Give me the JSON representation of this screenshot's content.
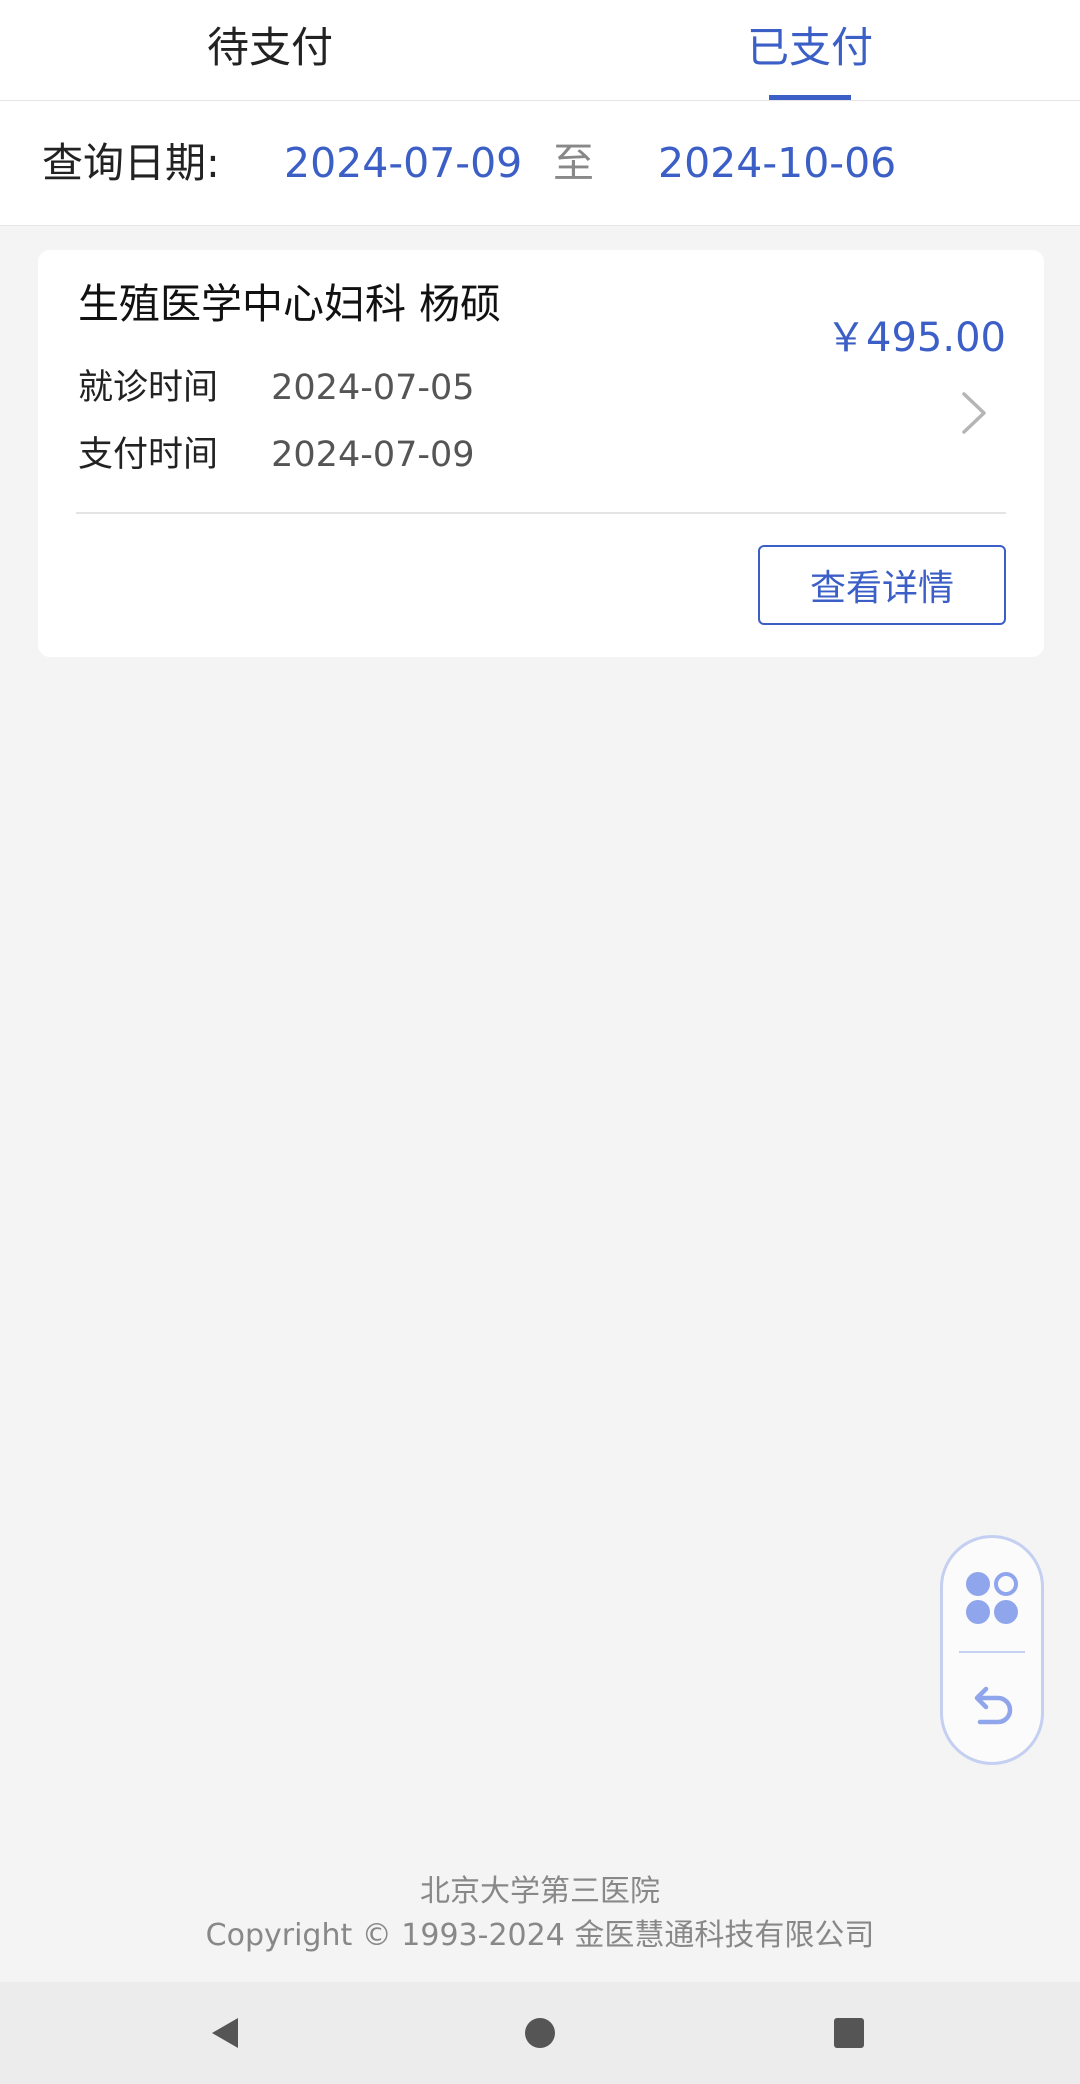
{
  "tabs": [
    {
      "label": "待支付",
      "active": false
    },
    {
      "label": "已支付",
      "active": true
    }
  ],
  "date_filter": {
    "label": "查询日期:",
    "start": "2024-07-09",
    "separator": "至",
    "end": "2024-10-06"
  },
  "records": [
    {
      "title": "生殖医学中心妇科 杨硕",
      "amount": "￥495.00",
      "visit_label": "就诊时间",
      "visit_date": "2024-07-05",
      "pay_label": "支付时间",
      "pay_date": "2024-07-09",
      "detail_button": "查看详情"
    }
  ],
  "floating_widget": {
    "top_icon": "clover-grid-icon",
    "bottom_icon": "undo-arrow-icon"
  },
  "footer": {
    "line1": "北京大学第三医院",
    "line2": "Copyright © 1993-2024 金医慧通科技有限公司"
  },
  "colors": {
    "accent": "#3b5fc6",
    "background": "#f4f4f4",
    "widget_border": "#c4cff2"
  },
  "system_nav": {
    "back_icon": "back-triangle-icon",
    "home_icon": "home-circle-icon",
    "recent_icon": "recent-square-icon"
  }
}
